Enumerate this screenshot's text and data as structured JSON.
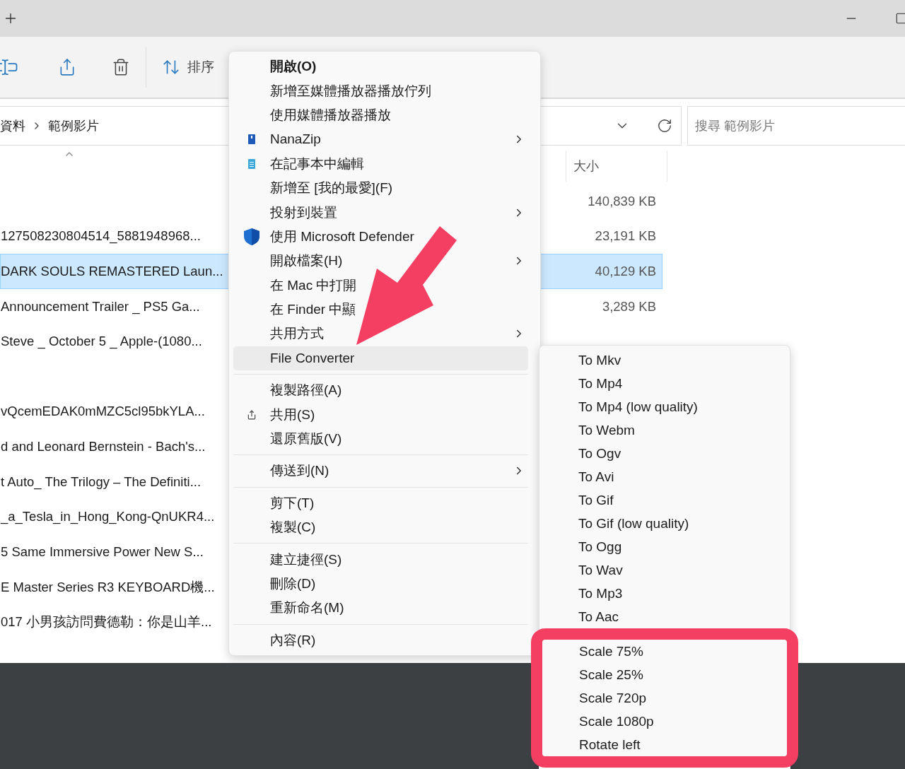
{
  "toolbar": {
    "sort_label": "排序"
  },
  "address_bar": {
    "breadcrumb": [
      "資料",
      "範例影片"
    ],
    "search": {
      "placeholder": "搜尋 範例影片"
    }
  },
  "file_list": {
    "columns": {
      "size": "大小"
    },
    "rows": [
      {
        "size": "140,839 KB",
        "selected": false
      },
      {
        "name": "127508230804514_5881948968...",
        "size": "23,191 KB",
        "selected": false
      },
      {
        "name": "DARK SOULS REMASTERED Laun...",
        "size": "40,129 KB",
        "selected": true
      },
      {
        "name": "Announcement Trailer _ PS5 Ga...",
        "size": "3,289 KB",
        "selected": false
      },
      {
        "name": "Steve _ October 5 _ Apple-(1080...",
        "selected": false
      },
      {
        "selected": false
      },
      {
        "name": "vQcemEDAK0mMZC5cl95bkYLA...",
        "selected": false
      },
      {
        "name": "d and Leonard Bernstein - Bach's...",
        "selected": false
      },
      {
        "name": "t Auto_ The Trilogy – The Definiti...",
        "selected": false
      },
      {
        "name": "_a_Tesla_in_Hong_Kong-QnUKR4...",
        "selected": false
      },
      {
        "name": "5  Same Immersive Power New S...",
        "selected": false
      },
      {
        "name": "E Master Series R3 KEYBOARD機...",
        "selected": false
      },
      {
        "name": "017 小男孩訪問費德勒：你是山羊...",
        "selected": false
      }
    ]
  },
  "context_menu": {
    "sections": [
      {
        "items": [
          {
            "label": "開啟(O)",
            "default": true,
            "submenu": false,
            "highlighted": false
          },
          {
            "label": "新增至媒體播放器播放佇列",
            "default": false,
            "submenu": false,
            "highlighted": false
          },
          {
            "label": "使用媒體播放器播放",
            "default": false,
            "submenu": false,
            "highlighted": false
          },
          {
            "label": "NanaZip",
            "kind": "archive",
            "default": false,
            "submenu": true,
            "highlighted": false
          },
          {
            "label": "在記事本中編輯",
            "kind": "notepad",
            "default": false,
            "submenu": false,
            "highlighted": false
          },
          {
            "label": "新增至 [我的最愛](F)",
            "default": false,
            "submenu": false,
            "highlighted": false
          },
          {
            "label": "投射到裝置",
            "default": false,
            "submenu": true,
            "highlighted": false
          },
          {
            "label": "使用 Microsoft Defender",
            "kind": "shield",
            "default": false,
            "submenu": false,
            "highlighted": false
          },
          {
            "label": "開啟檔案(H)",
            "default": false,
            "submenu": true,
            "highlighted": false
          },
          {
            "label": "在 Mac 中打開",
            "default": false,
            "submenu": false,
            "highlighted": false
          },
          {
            "label": "在 Finder 中顯",
            "default": false,
            "submenu": false,
            "highlighted": false
          },
          {
            "label": "共用方式",
            "default": false,
            "submenu": true,
            "highlighted": false
          },
          {
            "label": "File Converter",
            "default": false,
            "submenu": false,
            "highlighted": true
          }
        ]
      },
      {
        "items": [
          {
            "label": "複製路徑(A)",
            "default": false,
            "submenu": false,
            "highlighted": false
          },
          {
            "label": "共用(S)",
            "kind": "share",
            "default": false,
            "submenu": false,
            "highlighted": false
          },
          {
            "label": "還原舊版(V)",
            "default": false,
            "submenu": false,
            "highlighted": false
          }
        ]
      },
      {
        "items": [
          {
            "label": "傳送到(N)",
            "default": false,
            "submenu": true,
            "highlighted": false
          }
        ]
      },
      {
        "items": [
          {
            "label": "剪下(T)",
            "default": false,
            "submenu": false,
            "highlighted": false
          },
          {
            "label": "複製(C)",
            "default": false,
            "submenu": false,
            "highlighted": false
          }
        ]
      },
      {
        "items": [
          {
            "label": "建立捷徑(S)",
            "default": false,
            "submenu": false,
            "highlighted": false
          },
          {
            "label": "刪除(D)",
            "default": false,
            "submenu": false,
            "highlighted": false
          },
          {
            "label": "重新命名(M)",
            "default": false,
            "submenu": false,
            "highlighted": false
          }
        ]
      },
      {
        "items": [
          {
            "label": "內容(R)",
            "default": false,
            "submenu": false,
            "highlighted": false
          }
        ]
      }
    ]
  },
  "submenu": {
    "items": [
      {
        "label": "To Mkv",
        "framed": false
      },
      {
        "label": "To Mp4",
        "framed": false
      },
      {
        "label": "To Mp4 (low quality)",
        "framed": false
      },
      {
        "label": "To Webm",
        "framed": false
      },
      {
        "label": "To Ogv",
        "framed": false
      },
      {
        "label": "To Avi",
        "framed": false
      },
      {
        "label": "To Gif",
        "framed": false
      },
      {
        "label": "To Gif (low quality)",
        "framed": false
      },
      {
        "label": "To Ogg",
        "framed": false
      },
      {
        "label": "To Wav",
        "framed": false
      },
      {
        "label": "To Mp3",
        "framed": false
      },
      {
        "label": "To Aac",
        "framed": false
      },
      {
        "label": "Scale 75%",
        "framed": true
      },
      {
        "label": "Scale 25%",
        "framed": true
      },
      {
        "label": "Scale 720p",
        "framed": true
      },
      {
        "label": "Scale 1080p",
        "framed": true
      },
      {
        "label": "Rotate left",
        "framed": true
      }
    ]
  }
}
